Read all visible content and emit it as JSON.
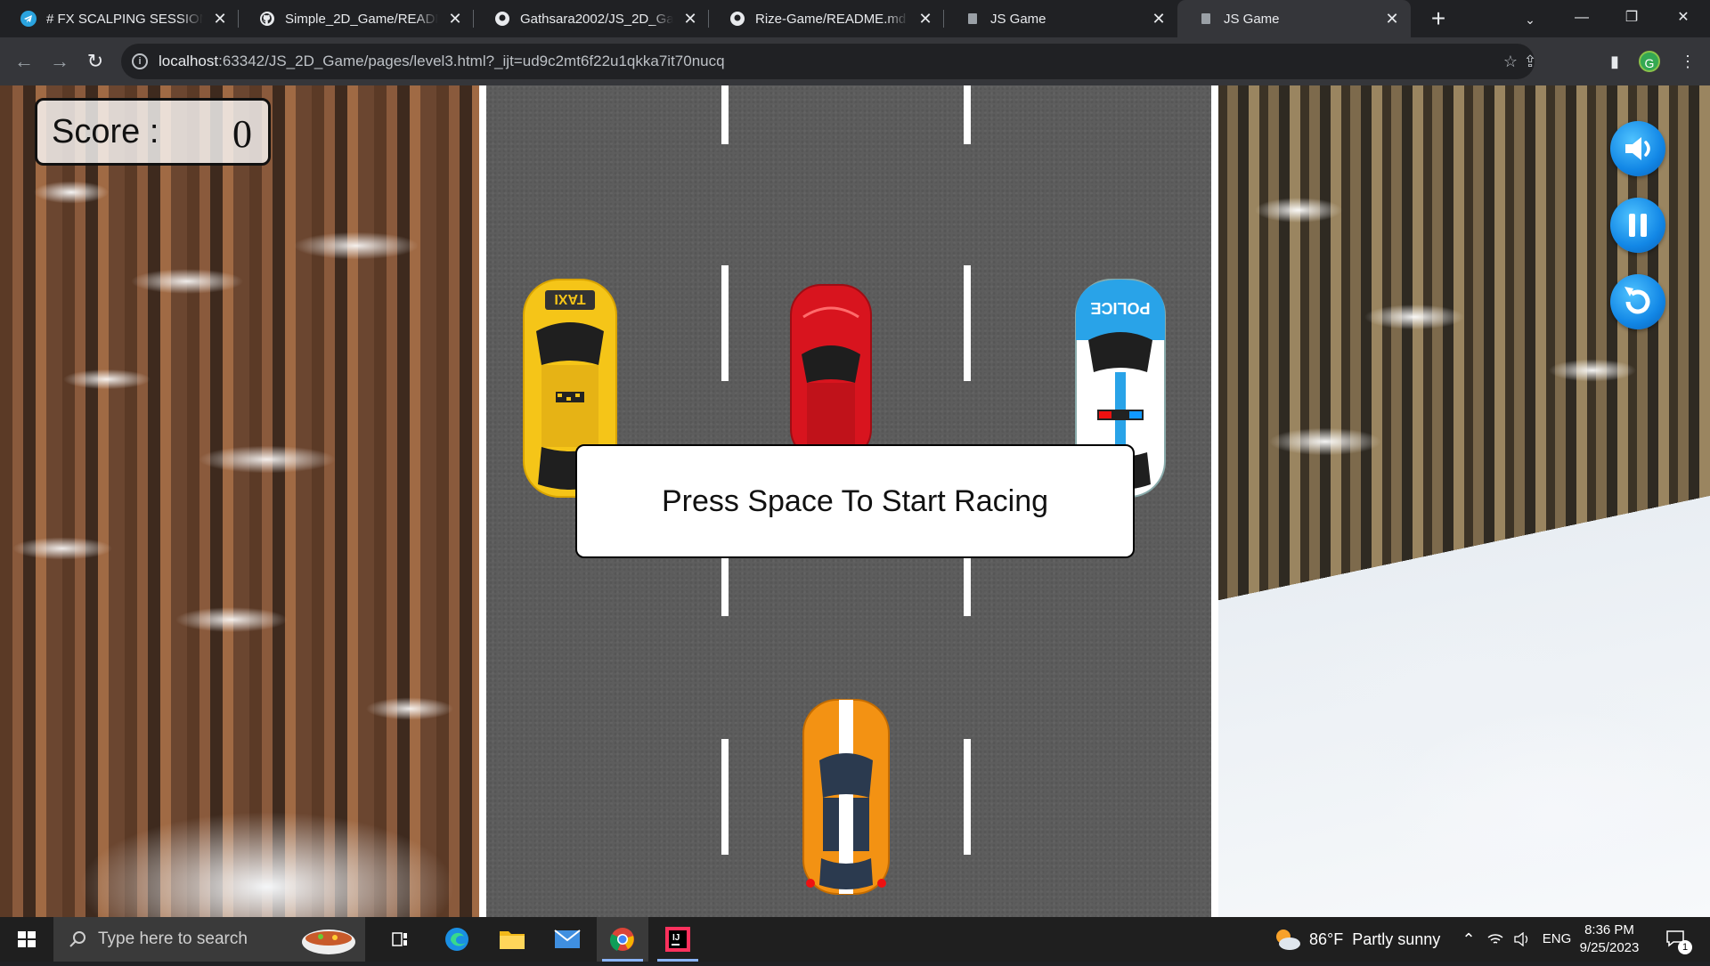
{
  "browser": {
    "tabs": [
      {
        "title": "# FX SCALPING SESSION C",
        "icon": "telegram-icon"
      },
      {
        "title": "Simple_2D_Game/README",
        "icon": "github-icon"
      },
      {
        "title": "Gathsara2002/JS_2D_Game",
        "icon": "github-icon"
      },
      {
        "title": "Rize-Game/README.md at",
        "icon": "github-icon"
      },
      {
        "title": "JS Game",
        "icon": "page-icon"
      },
      {
        "title": "JS Game",
        "icon": "page-icon",
        "active": true
      }
    ],
    "new_tab_label": "+",
    "url": {
      "host": "localhost",
      "rest": ":63342/JS_2D_Game/pages/level3.html?_ijt=ud9c2mt6f22u1qkka7it70nucq"
    },
    "profile_initial": "G"
  },
  "game": {
    "score_label": "Score :",
    "score_value": "0",
    "start_prompt": "Press Space To Start Racing",
    "controls": [
      "volume-icon",
      "pause-icon",
      "restart-icon"
    ],
    "cars": {
      "taxi": {
        "label": "TAXI",
        "color": "#f5c518"
      },
      "red": {
        "color": "#d8141e"
      },
      "police": {
        "label": "POLICE",
        "color": "#29a3e8"
      },
      "player": {
        "color": "#f39213"
      }
    }
  },
  "taskbar": {
    "search_placeholder": "Type here to search",
    "weather": {
      "temp": "86°F",
      "condition": "Partly sunny"
    },
    "language": "ENG",
    "time": "8:36 PM",
    "date": "9/25/2023",
    "notification_count": "1"
  }
}
